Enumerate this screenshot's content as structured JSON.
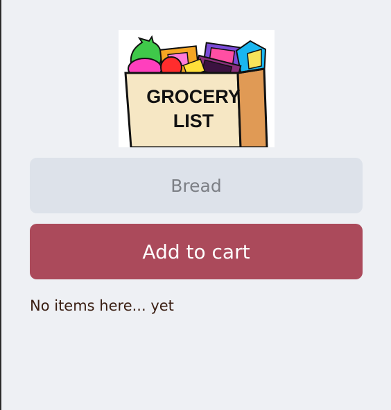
{
  "logo": {
    "line1": "GROCERY",
    "line2": "LIST",
    "icon": "grocery-bag-icon"
  },
  "form": {
    "input_value": "Bread",
    "input_placeholder": "",
    "button_label": "Add to cart"
  },
  "list": {
    "empty_message": "No items here... yet"
  },
  "colors": {
    "background": "#eef0f4",
    "input_background": "#dde2ea",
    "button_background": "#ab4a5b",
    "button_text": "#ffffff",
    "message_text": "#3a1e12"
  }
}
